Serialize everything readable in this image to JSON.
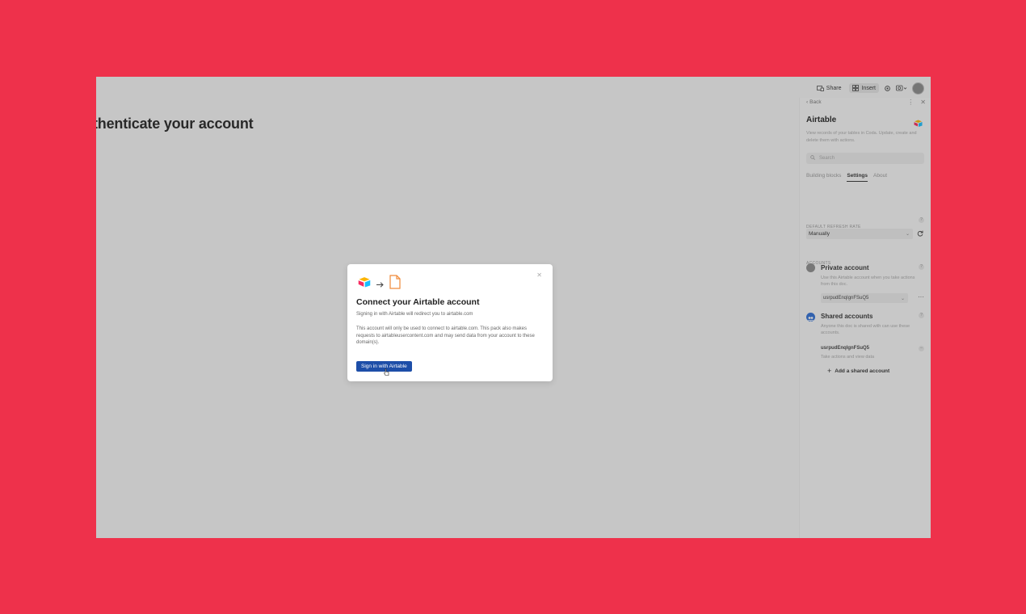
{
  "document": {
    "title": "thenticate your account"
  },
  "toolbar": {
    "share_label": "Share",
    "insert_label": "Insert"
  },
  "panel": {
    "back_label": "Back",
    "title": "Airtable",
    "description": "View records of your tables in Coda. Update, create and delete them with actions.",
    "search_placeholder": "Search",
    "tabs": [
      {
        "label": "Building blocks",
        "active": false
      },
      {
        "label": "Settings",
        "active": true
      },
      {
        "label": "About",
        "active": false
      }
    ],
    "refresh_rate": {
      "label": "DEFAULT REFRESH RATE",
      "value": "Manually"
    },
    "accounts": {
      "label": "ACCOUNTS",
      "private": {
        "title": "Private account",
        "description": "Use this Airtable account when you take actions from this doc.",
        "selected": "usrpudEnqIgnFSuQ5"
      },
      "shared": {
        "title": "Shared accounts",
        "description": "Anyone this doc is shared with can use these accounts.",
        "account_name": "usrpudEnqIgnFSuQ5",
        "account_desc": "Take actions and view data",
        "add_label": "Add a shared account"
      }
    }
  },
  "modal": {
    "title": "Connect your Airtable account",
    "subtitle": "Signing in with Airtable will redirect you to airtable.com",
    "body": "This account will only be used to connect to airtable.com. This pack also makes requests to airtableusercontent.com and may send data from your account to these domain(s).",
    "button_label": "Sign in with Airtable"
  },
  "colors": {
    "background": "#ee314b",
    "primary_button": "#1d4ea8",
    "shared_avatar": "#2f6fd6"
  }
}
